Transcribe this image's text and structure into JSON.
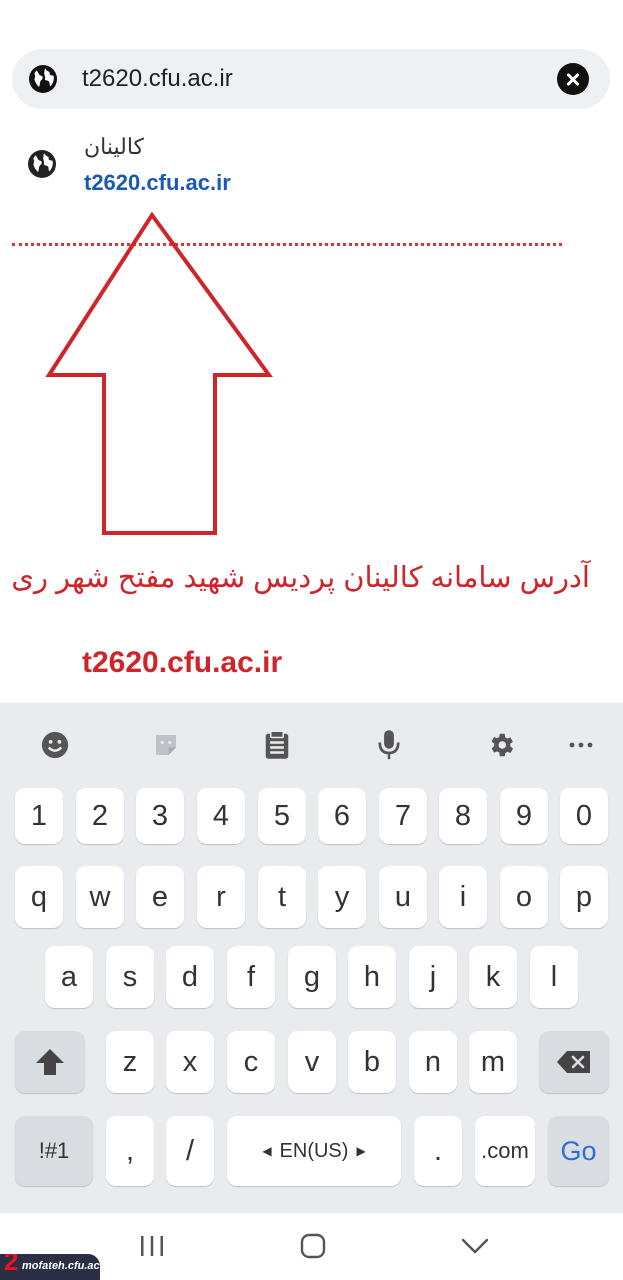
{
  "browser": {
    "url_value": "t2620.cfu.ac.ir",
    "suggestion": {
      "title": "کالینان",
      "url": "t2620.cfu.ac.ir"
    }
  },
  "annotation": {
    "caption": "آدرس سامانه کالینان پردیس شهید مفتح شهر ری",
    "url": "t2620.cfu.ac.ir",
    "color": "#d0242b"
  },
  "keyboard": {
    "toolbar": [
      "emoji-icon",
      "sticker-icon",
      "clipboard-icon",
      "microphone-icon",
      "gear-icon",
      "more-icon"
    ],
    "number_row": [
      "1",
      "2",
      "3",
      "4",
      "5",
      "6",
      "7",
      "8",
      "9",
      "0"
    ],
    "row1": [
      "q",
      "w",
      "e",
      "r",
      "t",
      "y",
      "u",
      "i",
      "o",
      "p"
    ],
    "row2": [
      "a",
      "s",
      "d",
      "f",
      "g",
      "h",
      "j",
      "k",
      "l"
    ],
    "row3": [
      "z",
      "x",
      "c",
      "v",
      "b",
      "n",
      "m"
    ],
    "symbols_label": "!#1",
    "comma_label": ",",
    "slash_label": "/",
    "language_label": "EN(US)",
    "period_label": ".",
    "dotcom_label": ".com",
    "go_label": "Go"
  },
  "watermark": {
    "number": "2",
    "text": "mofateh.cfu.ac.ir"
  }
}
